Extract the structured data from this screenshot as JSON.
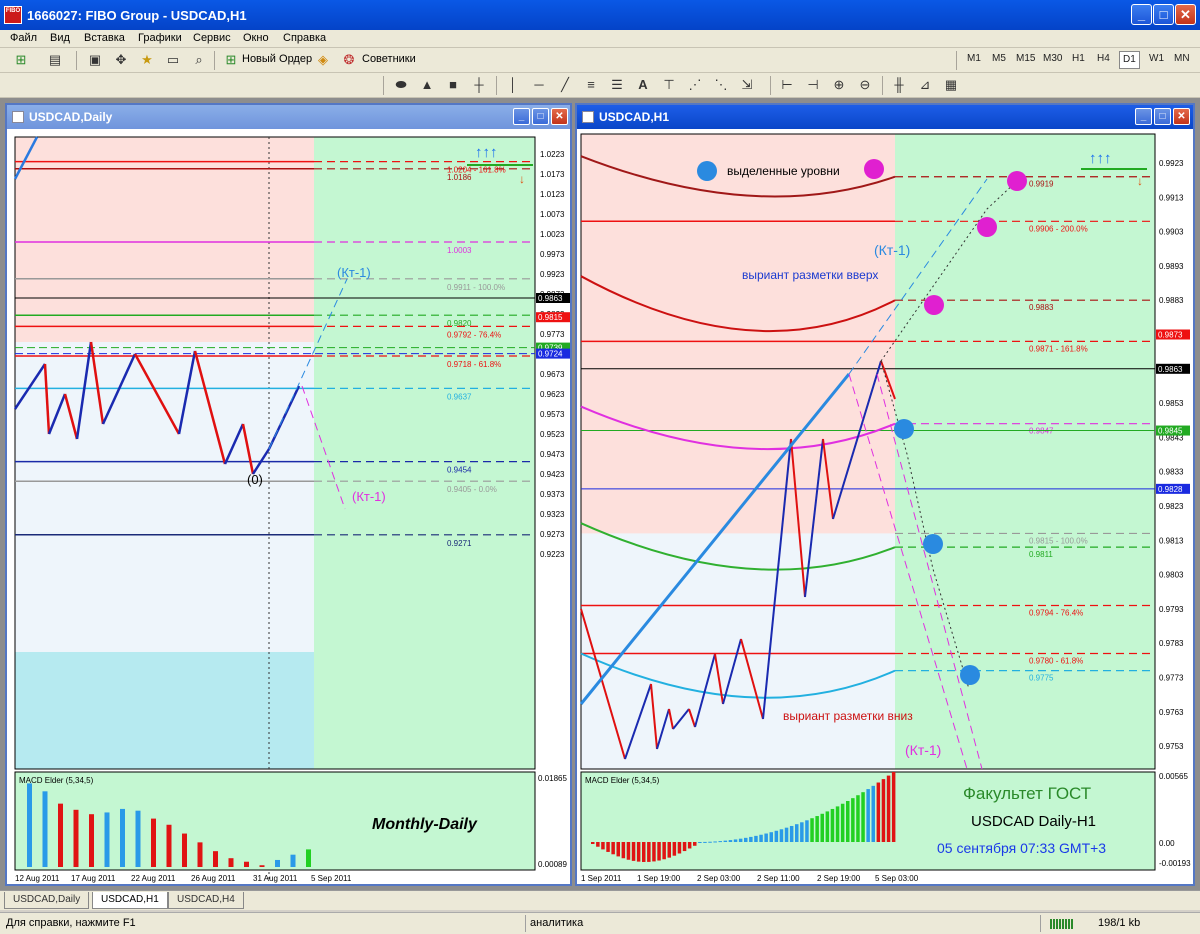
{
  "app": {
    "title": "1666027: FIBO Group - USDCAD,H1",
    "icon_label": "FIBO",
    "window_buttons": [
      "minimize-icon",
      "maximize-icon",
      "close-icon"
    ]
  },
  "menu": [
    "Файл",
    "Вид",
    "Вставка",
    "Графики",
    "Сервис",
    "Окно",
    "Справка"
  ],
  "toolbar": {
    "new_order": "Новый Ордер",
    "advisors": "Советники",
    "timeframes": [
      "M1",
      "M5",
      "M15",
      "M30",
      "H1",
      "H4",
      "D1",
      "W1",
      "MN"
    ],
    "selected_timeframe": "D1"
  },
  "left_chart": {
    "title": "USDCAD,Daily",
    "price_scale": [
      "1.0223",
      "1.0173",
      "1.0123",
      "1.0073",
      "1.0023",
      "0.9973",
      "0.9923",
      "0.9873",
      "0.9823",
      "0.9773",
      "0.9723",
      "0.9673",
      "0.9623",
      "0.9573",
      "0.9523",
      "0.9473",
      "0.9423",
      "0.9373",
      "0.9323",
      "0.9273",
      "0.9223"
    ],
    "levels": [
      {
        "label": "1.0204 - 161.8%",
        "price": 1.0204,
        "color": "#ee1111"
      },
      {
        "label": "1.0186",
        "price": 1.0186,
        "color": "#aa1111"
      },
      {
        "label": "1.0003",
        "price": 1.0003,
        "color": "#e030e0"
      },
      {
        "label": "0.9911 - 100.0%",
        "price": 0.9911,
        "color": "#999999"
      },
      {
        "label": "0.9820",
        "price": 0.982,
        "color": "#22aa22"
      },
      {
        "label": "0.9792 - 76.4%",
        "price": 0.9792,
        "color": "#ee1111"
      },
      {
        "label": "0.9718 - 61.8%",
        "price": 0.9718,
        "color": "#ee1111"
      },
      {
        "label": "0.9637",
        "price": 0.9637,
        "color": "#22b0e0"
      },
      {
        "label": "0.9454",
        "price": 0.9454,
        "color": "#1a2aa8"
      },
      {
        "label": "0.9405 - 0.0%",
        "price": 0.9405,
        "color": "#999999"
      },
      {
        "label": "0.9271",
        "price": 0.9271,
        "color": "#1a2a78"
      }
    ],
    "price_tags": [
      {
        "label": "0.9863",
        "bg": "#000000"
      },
      {
        "label": "0.9815",
        "bg": "#ee1111"
      },
      {
        "label": "0.9739",
        "bg": "#22aa22"
      },
      {
        "label": "0.9724",
        "bg": "#1a2ae0"
      }
    ],
    "annotations": {
      "kt_up": "(Кт-1)",
      "kt_down": "(Кт-1)",
      "zero": "(0)",
      "caption": "Monthly-Daily"
    },
    "macd": {
      "title": "MACD Elder (5,34,5)",
      "scale_top": "0.01865",
      "scale_bottom": "0.00089",
      "bars": [
        0.95,
        0.86,
        0.72,
        0.65,
        0.6,
        0.62,
        0.66,
        0.64,
        0.55,
        0.48,
        0.38,
        0.28,
        0.18,
        0.1,
        0.06,
        0.02,
        0.08,
        0.14,
        0.2
      ],
      "colors": [
        "b",
        "b",
        "r",
        "r",
        "r",
        "b",
        "b",
        "b",
        "r",
        "r",
        "r",
        "r",
        "r",
        "r",
        "r",
        "r",
        "b",
        "b",
        "g"
      ]
    },
    "dates": [
      "12 Aug 2011",
      "17 Aug 2011",
      "22 Aug 2011",
      "26 Aug 2011",
      "31 Aug 2011",
      "5 Sep 2011"
    ]
  },
  "right_chart": {
    "title": "USDCAD,H1",
    "price_scale": [
      "0.9923",
      "0.9913",
      "0.9903",
      "0.9893",
      "0.9883",
      "0.9863",
      "0.9853",
      "0.9843",
      "0.9833",
      "0.9823",
      "0.9813",
      "0.9803",
      "0.9793",
      "0.9783",
      "0.9773",
      "0.9763",
      "0.9753"
    ],
    "levels": [
      {
        "label": "0.9919",
        "price": 0.9919,
        "color": "#aa1111"
      },
      {
        "label": "0.9906 - 200.0%",
        "price": 0.9906,
        "color": "#ee1111"
      },
      {
        "label": "0.9883",
        "price": 0.9883,
        "color": "#aa1111"
      },
      {
        "label": "0.9871 - 161.8%",
        "price": 0.9871,
        "color": "#ee1111"
      },
      {
        "label": "0.9847",
        "price": 0.9847,
        "color": "#e030e0"
      },
      {
        "label": "0.9815 - 100.0%",
        "price": 0.9815,
        "color": "#999999"
      },
      {
        "label": "0.9811",
        "price": 0.9811,
        "color": "#22aa22"
      },
      {
        "label": "0.9794 - 76.4%",
        "price": 0.9794,
        "color": "#ee1111"
      },
      {
        "label": "0.9780 - 61.8%",
        "price": 0.978,
        "color": "#ee1111"
      },
      {
        "label": "0.9775",
        "price": 0.9775,
        "color": "#22b0e0"
      }
    ],
    "price_tags": [
      {
        "label": "0.9873",
        "bg": "#ee1111"
      },
      {
        "label": "0.9863",
        "bg": "#000000"
      },
      {
        "label": "0.9845",
        "bg": "#22aa22"
      },
      {
        "label": "0.9828",
        "bg": "#1a2ae0"
      }
    ],
    "annotations": {
      "highlighted_levels": "выделенные уровни",
      "kt_up": "(Кт-1)",
      "variant_up": "выриант разметки вверх",
      "variant_down": "выриант разметки вниз",
      "kt_down": "(Кт-1)",
      "faculty": "Факультет ГОСТ",
      "pair": "USDCAD Daily-H1",
      "date": "05 сентября 07:33 GMT+3"
    },
    "macd": {
      "title": "MACD Elder (5,34,5)",
      "scale_top": "0.00565",
      "scale_mid": "0.00",
      "scale_bottom": "-0.00193"
    },
    "dates": [
      "1 Sep 2011",
      "1 Sep 19:00",
      "2 Sep 03:00",
      "2 Sep 11:00",
      "2 Sep 19:00",
      "5 Sep 03:00"
    ]
  },
  "tabs": [
    "USDCAD,Daily",
    "USDCAD,H1",
    "USDCAD,H4"
  ],
  "selected_tab": "USDCAD,H1",
  "status": {
    "help": "Для справки, нажмите F1",
    "profile": "аналитика",
    "traffic": "198/1 kb"
  }
}
